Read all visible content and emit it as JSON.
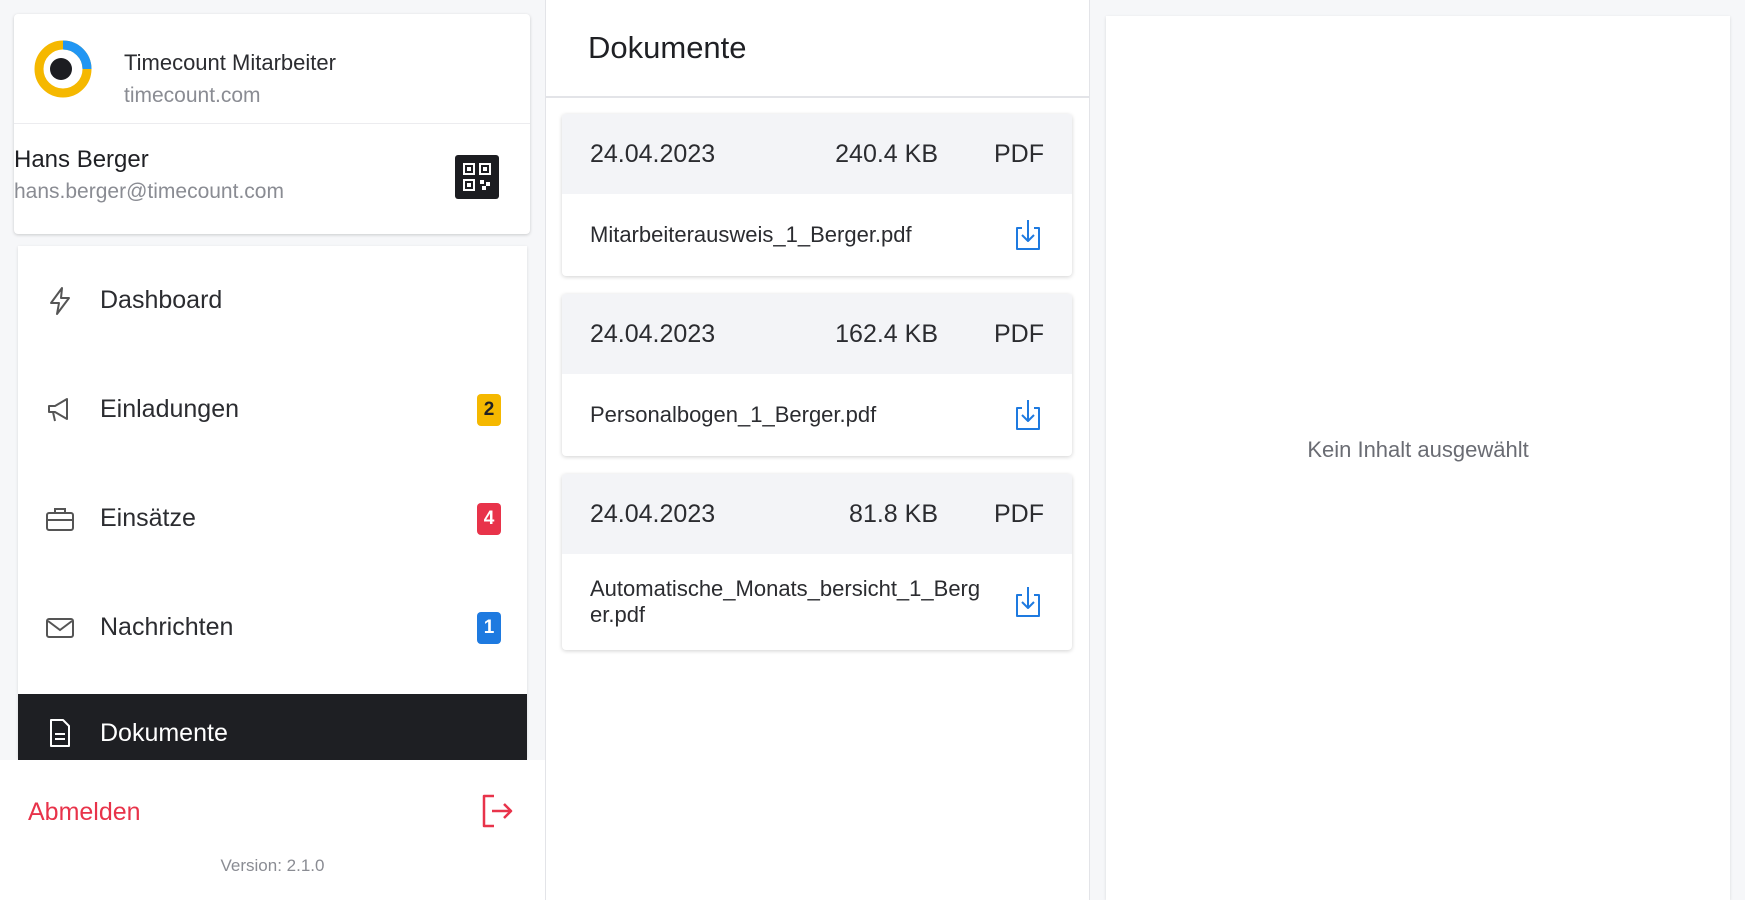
{
  "app": {
    "name": "Timecount Mitarbeiter",
    "domain": "timecount.com"
  },
  "user": {
    "name": "Hans Berger",
    "email": "hans.berger@timecount.com"
  },
  "nav": {
    "items": [
      {
        "label": "Dashboard",
        "icon": "lightning-icon",
        "badge": null
      },
      {
        "label": "Einladungen",
        "icon": "megaphone-icon",
        "badge": "2",
        "badge_color": "#f5b800"
      },
      {
        "label": "Einsätze",
        "icon": "briefcase-icon",
        "badge": "4",
        "badge_color": "#e8334a"
      },
      {
        "label": "Nachrichten",
        "icon": "mail-icon",
        "badge": "1",
        "badge_color": "#1e7ae0"
      },
      {
        "label": "Dokumente",
        "icon": "document-icon",
        "badge": null,
        "active": true
      }
    ]
  },
  "footer": {
    "logout": "Abmelden",
    "version": "Version: 2.1.0"
  },
  "documents": {
    "title": "Dokumente",
    "items": [
      {
        "date": "24.04.2023",
        "size": "240.4 KB",
        "type": "PDF",
        "name": "Mitarbeiterausweis_1_Berger.pdf"
      },
      {
        "date": "24.04.2023",
        "size": "162.4 KB",
        "type": "PDF",
        "name": "Personalbogen_1_Berger.pdf"
      },
      {
        "date": "24.04.2023",
        "size": "81.8 KB",
        "type": "PDF",
        "name": "Automatische_Monats_bersicht_1_Berger.pdf"
      }
    ]
  },
  "detail": {
    "empty_text": "Kein Inhalt ausgewählt"
  },
  "colors": {
    "accent": "#1e7ae0",
    "danger": "#e8334a",
    "warning": "#f5b800",
    "active_nav": "#1e1f23"
  }
}
